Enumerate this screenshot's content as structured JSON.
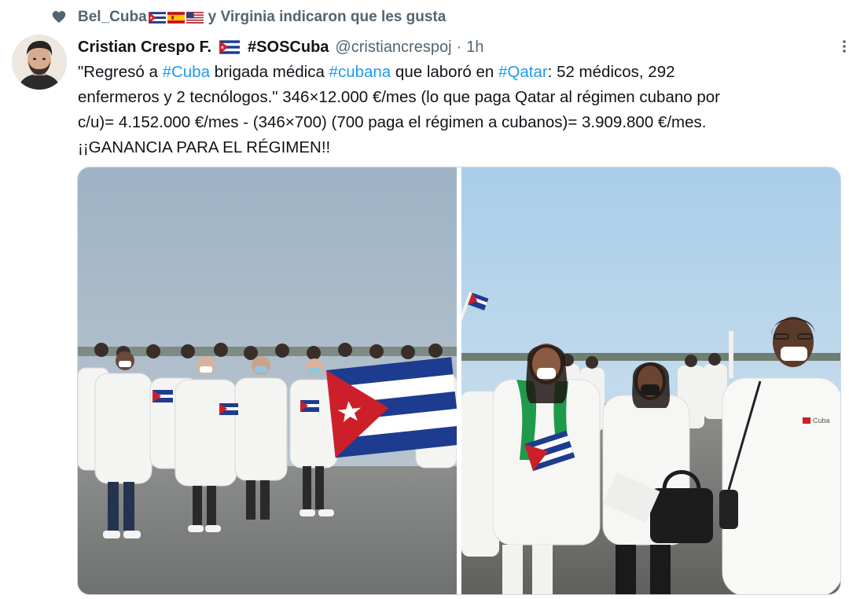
{
  "social_context": {
    "user": "Bel_Cuba",
    "text": "y Virginia indicaron que les gusta"
  },
  "tweet": {
    "display_name": "Cristian Crespo F.",
    "name_hashtag": "#SOSCuba",
    "handle": "@cristiancrespoj",
    "separator": "·",
    "time": "1h",
    "text_segments": {
      "l1_a": "\"Regresó a ",
      "l1_tag1": "#Cuba",
      "l1_b": " brigada médica ",
      "l1_tag2": "#cubana",
      "l1_c": " que laboró en ",
      "l1_tag3": "#Qatar",
      "l1_d": ": 52 médicos, 292",
      "l2": "enfermeros y 2 tecnólogos.\" 346×12.000 €/mes (lo que paga Qatar al régimen cubano por",
      "l3": "c/u)= 4.152.000 €/mes - (346×700) (700 paga el régimen a cubanos)= 3.909.800 €/mes.",
      "l4": "¡¡GANANCIA PARA EL RÉGIMEN!!"
    }
  },
  "photo_texts": {
    "coat_logo": "Cuba"
  },
  "colors": {
    "link": "#1d9bf0",
    "secondary_text": "#536471",
    "cuba_blue": "#1d3c8f",
    "cuba_red": "#cc1f2a"
  },
  "icons": [
    "heart-icon",
    "more-options-icon",
    "cuba-flag-icon",
    "spain-flag-icon",
    "us-flag-icon"
  ]
}
